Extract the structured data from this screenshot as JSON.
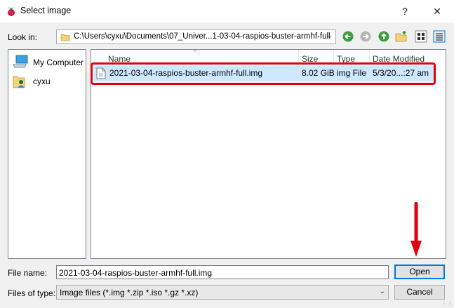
{
  "window": {
    "title": "Select image",
    "help_label": "?",
    "close_label": "✕"
  },
  "lookin": {
    "label": "Look in:",
    "path": "C:\\Users\\cyxu\\Documents\\07_Univer...1-03-04-raspios-buster-armhf-full"
  },
  "nav_icons": [
    "back-icon",
    "forward-icon",
    "up-folder-icon",
    "new-folder-icon",
    "list-view-icon",
    "detail-view-icon"
  ],
  "places": [
    {
      "label": "My Computer",
      "icon": "computer-icon"
    },
    {
      "label": "cyxu",
      "icon": "user-folder-icon"
    }
  ],
  "columns": {
    "name": "Name",
    "size": "Size",
    "type": "Type",
    "date": "Date Modified"
  },
  "files": [
    {
      "name": "2021-03-04-raspios-buster-armhf-full.img",
      "size": "8.02 GiB",
      "type": "img File",
      "date": "5/3/20...:27 am"
    }
  ],
  "footer": {
    "filename_label": "File name:",
    "filename_value": "2021-03-04-raspios-buster-armhf-full.img",
    "filetype_label": "Files of type:",
    "filetype_value": "Image files (*.img *.zip *.iso *.gz *.xz)",
    "open_label": "Open",
    "cancel_label": "Cancel"
  },
  "colors": {
    "selection": "#cde8ff",
    "highlight_box": "#e00010",
    "green_nav": "#3c9b3c"
  }
}
